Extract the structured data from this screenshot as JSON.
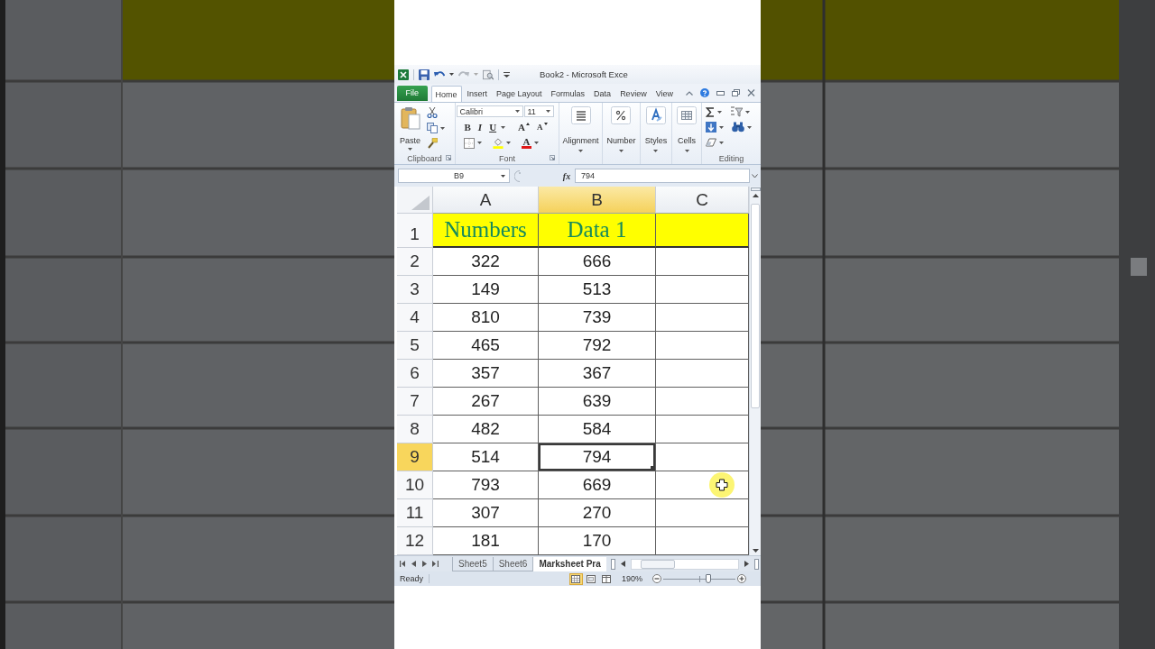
{
  "title_bar": {
    "title": "Book2 - Microsoft Exce"
  },
  "ribbon_tabs": [
    {
      "label": "File",
      "kind": "file",
      "selected": false
    },
    {
      "label": "Home",
      "kind": "tab",
      "selected": true
    },
    {
      "label": "Insert",
      "kind": "tab",
      "selected": false
    },
    {
      "label": "Page Layout",
      "kind": "tab",
      "selected": false
    },
    {
      "label": "Formulas",
      "kind": "tab",
      "selected": false
    },
    {
      "label": "Data",
      "kind": "tab",
      "selected": false
    },
    {
      "label": "Review",
      "kind": "tab",
      "selected": false
    },
    {
      "label": "View",
      "kind": "tab",
      "selected": false
    }
  ],
  "ribbon": {
    "clipboard": {
      "label": "Clipboard",
      "paste_label": "Paste"
    },
    "font": {
      "label": "Font",
      "font_name": "Calibri",
      "font_size": "11",
      "format_buttons": [
        {
          "kind": "bold",
          "label": "B"
        },
        {
          "kind": "italic",
          "label": "I"
        },
        {
          "kind": "underline",
          "label": "U"
        },
        {
          "kind": "grow",
          "label": "A"
        },
        {
          "kind": "shrink",
          "label": "A"
        }
      ],
      "font_color_label": "A"
    },
    "collapsed_groups": [
      {
        "kind": "alignment",
        "label": "Alignment"
      },
      {
        "kind": "number",
        "label": "Number"
      },
      {
        "kind": "styles",
        "label": "Styles"
      },
      {
        "kind": "cells",
        "label": "Cells"
      }
    ],
    "editing": {
      "label": "Editing"
    }
  },
  "formula_bar": {
    "name_box": "B9",
    "function_label": "fx",
    "value": "794"
  },
  "sheet": {
    "columns": [
      {
        "label": "A",
        "selected": false
      },
      {
        "label": "B",
        "selected": true
      },
      {
        "label": "C",
        "selected": false
      }
    ],
    "rows": [
      {
        "number": "1",
        "kind": "title",
        "selected": false,
        "cells": [
          {
            "text": "Numbers",
            "selected": false
          },
          {
            "text": "Data 1",
            "selected": false
          },
          {
            "selected": false
          }
        ]
      },
      {
        "number": "2",
        "kind": "data",
        "selected": false,
        "cells": [
          {
            "text": "322",
            "selected": false
          },
          {
            "text": "666",
            "selected": false
          },
          {
            "selected": false
          }
        ]
      },
      {
        "number": "3",
        "kind": "data",
        "selected": false,
        "cells": [
          {
            "text": "149",
            "selected": false
          },
          {
            "text": "513",
            "selected": false
          },
          {
            "selected": false
          }
        ]
      },
      {
        "number": "4",
        "kind": "data",
        "selected": false,
        "cells": [
          {
            "text": "810",
            "selected": false
          },
          {
            "text": "739",
            "selected": false
          },
          {
            "selected": false
          }
        ]
      },
      {
        "number": "5",
        "kind": "data",
        "selected": false,
        "cells": [
          {
            "text": "465",
            "selected": false
          },
          {
            "text": "792",
            "selected": false
          },
          {
            "selected": false
          }
        ]
      },
      {
        "number": "6",
        "kind": "data",
        "selected": false,
        "cells": [
          {
            "text": "357",
            "selected": false
          },
          {
            "text": "367",
            "selected": false
          },
          {
            "selected": false
          }
        ]
      },
      {
        "number": "7",
        "kind": "data",
        "selected": false,
        "cells": [
          {
            "text": "267",
            "selected": false
          },
          {
            "text": "639",
            "selected": false
          },
          {
            "selected": false
          }
        ]
      },
      {
        "number": "8",
        "kind": "data",
        "selected": false,
        "cells": [
          {
            "text": "482",
            "selected": false
          },
          {
            "text": "584",
            "selected": false
          },
          {
            "selected": false
          }
        ]
      },
      {
        "number": "9",
        "kind": "data",
        "selected": true,
        "cells": [
          {
            "text": "514",
            "selected": false
          },
          {
            "text": "794",
            "selected": true
          },
          {
            "selected": false
          }
        ]
      },
      {
        "number": "10",
        "kind": "data",
        "selected": false,
        "cells": [
          {
            "text": "793",
            "selected": false
          },
          {
            "text": "669",
            "selected": false
          },
          {
            "selected": false
          }
        ]
      },
      {
        "number": "11",
        "kind": "data",
        "selected": false,
        "cells": [
          {
            "text": "307",
            "selected": false
          },
          {
            "text": "270",
            "selected": false
          },
          {
            "selected": false
          }
        ]
      },
      {
        "number": "12",
        "kind": "data",
        "selected": false,
        "cells": [
          {
            "text": "181",
            "selected": false
          },
          {
            "text": "170",
            "selected": false
          },
          {
            "selected": false
          }
        ]
      }
    ]
  },
  "sheet_tabs": [
    {
      "label": "Sheet5",
      "selected": false
    },
    {
      "label": "Sheet6",
      "selected": false
    },
    {
      "label": "Marksheet Pra",
      "selected": true
    }
  ],
  "status_bar": {
    "status": "Ready",
    "views": [
      {
        "kind": "normal",
        "selected": true
      },
      {
        "kind": "page_layout",
        "selected": false
      },
      {
        "kind": "page_break",
        "selected": false
      }
    ],
    "zoom": "190%",
    "zoom_slider": {
      "level": 0.63
    }
  }
}
